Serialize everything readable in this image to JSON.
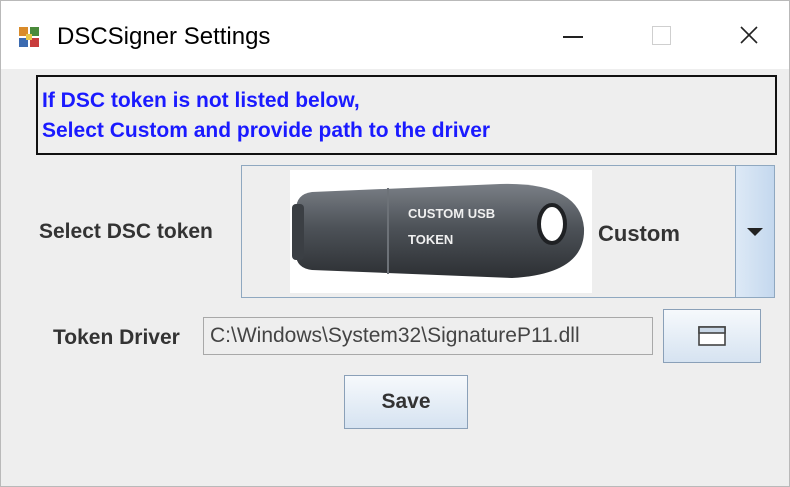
{
  "window": {
    "title": "DSCSigner Settings",
    "app_icon": "puzzle-cube-icon",
    "controls": {
      "minimize": "minimize-icon",
      "maximize": "maximize-icon",
      "close": "close-icon"
    }
  },
  "info": {
    "line1": "If DSC token is not listed below,",
    "line2": "Select Custom and provide path to the driver",
    "text_color": "#1a1aff"
  },
  "token_select": {
    "label": "Select DSC token",
    "selected_value": "Custom",
    "image_text_line1": "CUSTOM USB",
    "image_text_line2": "TOKEN",
    "dropdown_icon": "triangle-down-icon"
  },
  "driver": {
    "label": "Token Driver",
    "value": "C:\\Windows\\System32\\SignatureP11.dll",
    "browse_icon": "folder-window-icon"
  },
  "actions": {
    "save_label": "Save"
  }
}
